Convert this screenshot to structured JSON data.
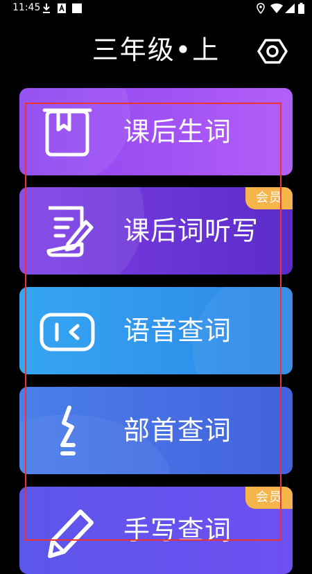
{
  "status_bar": {
    "time": "11:45",
    "icons": [
      "download-icon",
      "a-letter-icon",
      "square-icon",
      "location-icon",
      "wifi-icon",
      "signal-icon",
      "battery-icon"
    ]
  },
  "header": {
    "title": "三年级•上",
    "settings_icon": "gear-icon"
  },
  "menu": {
    "items": [
      {
        "label": "课后生词",
        "icon": "book-icon",
        "vip": false
      },
      {
        "label": "课后词听写",
        "icon": "edit-note-icon",
        "vip": true,
        "badge": "会员"
      },
      {
        "label": "语音查词",
        "icon": "voice-search-icon",
        "vip": false
      },
      {
        "label": "部首查词",
        "icon": "radical-stroke-icon",
        "vip": false
      },
      {
        "label": "手写查词",
        "icon": "pen-icon",
        "vip": true,
        "badge": "会员"
      }
    ]
  },
  "colors": {
    "background": "#000000",
    "vip_badge": "#f5b54a",
    "highlight": "#ee3333",
    "card_purple": "#8d43f0",
    "card_violet": "#6a35d8",
    "card_sky": "#35a6f2",
    "card_blue": "#4a7fea",
    "card_indigo": "#5b56ea"
  }
}
